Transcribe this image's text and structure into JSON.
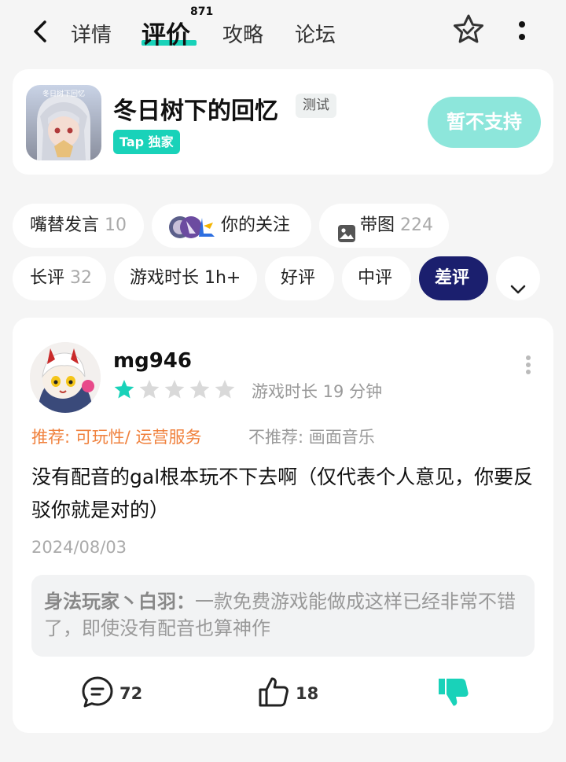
{
  "tabs": {
    "detail": "详情",
    "review": "评价",
    "review_count": "871",
    "guide": "攻略",
    "forum": "论坛"
  },
  "game": {
    "title": "冬日树下的回忆",
    "test_badge": "测试",
    "tap_badge": "Tap 独家",
    "action_button": "暂不支持",
    "icon_text": "冬日树下回忆"
  },
  "filters": {
    "row1": [
      {
        "label": "嘴替发言",
        "count": "10"
      },
      {
        "label": "你的关注",
        "count": ""
      },
      {
        "label": "带图",
        "count": "224"
      }
    ],
    "row2": [
      {
        "label": "长评",
        "count": "32"
      },
      {
        "label": "游戏时长 1h+",
        "count": ""
      },
      {
        "label": "好评",
        "count": ""
      },
      {
        "label": "中评",
        "count": ""
      },
      {
        "label": "差评",
        "count": "",
        "active": true
      }
    ]
  },
  "review": {
    "username": "mg946",
    "rating": 1,
    "rating_max": 5,
    "playtime": "游戏时长 19 分钟",
    "recommend": "推荐: 可玩性/ 运营服务",
    "not_recommend": "不推荐: 画面音乐",
    "text": "没有配音的gal根本玩不下去啊（仅代表个人意见，你要反驳你就是对的）",
    "date": "2024/08/03",
    "reply": {
      "author": "身法玩家丶白羽：",
      "text": "一款免费游戏能做成这样已经非常不错了，即使没有配音也算神作"
    },
    "comments": "72",
    "likes": "18"
  },
  "colors": {
    "accent": "#19d2b9",
    "active_chip": "#1b1f6e",
    "star_filled": "#19d2b9",
    "star_empty": "#d9d9d9",
    "recommend": "#f0813d"
  }
}
